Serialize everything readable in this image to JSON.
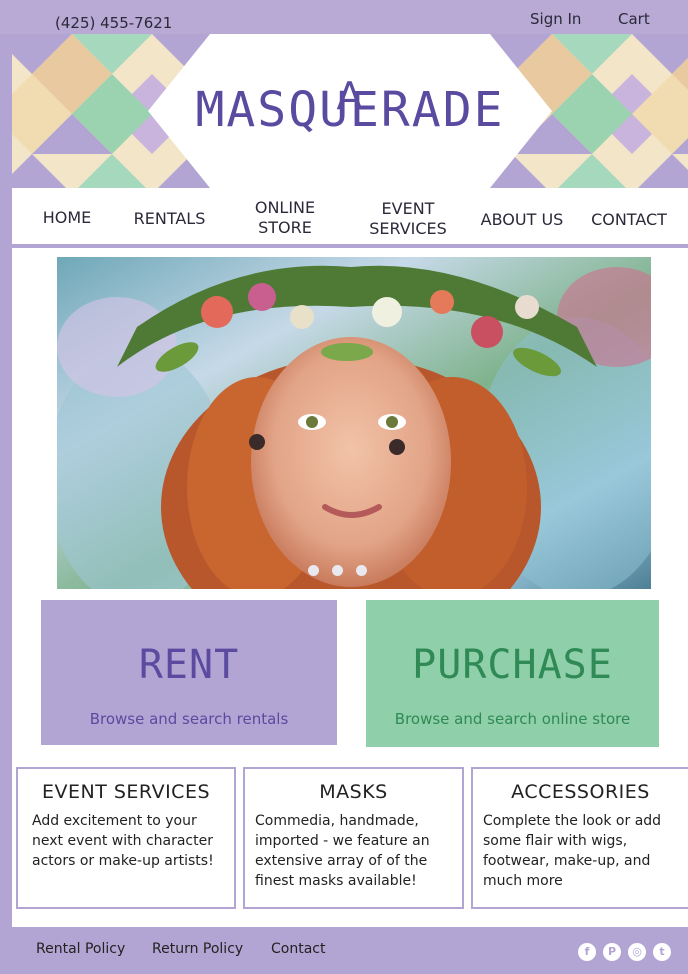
{
  "topbar": {
    "phone": "(425) 455-7621",
    "sign_in": "Sign In",
    "cart": "Cart"
  },
  "logo": {
    "line1": "A",
    "line2": "MASQUERADE"
  },
  "nav": {
    "home": "HOME",
    "rentals": "RENTALS",
    "online_store_1": "ONLINE",
    "online_store_2": "STORE",
    "event_services_1": "EVENT",
    "event_services_2": "SERVICES",
    "about": "ABOUT US",
    "contact": "CONTACT"
  },
  "carousel": {
    "slide_count": 3,
    "active_slide": 1
  },
  "cards": {
    "rent": {
      "title": "RENT",
      "subtitle": "Browse and search rentals"
    },
    "purchase": {
      "title": "PURCHASE",
      "subtitle": "Browse and search online store"
    }
  },
  "features": [
    {
      "title": "EVENT SERVICES",
      "body": "Add excitement to your next event with character actors or make-up artists!"
    },
    {
      "title": "MASKS",
      "body": "Commedia, handmade, imported - we feature an extensive array of of the finest masks available!"
    },
    {
      "title": "ACCESSORIES",
      "body": "Complete the look or add some flair with wigs, footwear, make-up, and much more"
    }
  ],
  "footer": {
    "rental_policy": "Rental Policy",
    "return_policy": "Return Policy",
    "contact": "Contact"
  },
  "social_icons": [
    "facebook-icon",
    "pinterest-icon",
    "instagram-icon",
    "twitter-icon"
  ],
  "colors": {
    "lavender": "#b3a5d3",
    "mint": "#8fcfaa",
    "purple_text": "#5a4aa0",
    "green_text": "#2f8a55"
  }
}
